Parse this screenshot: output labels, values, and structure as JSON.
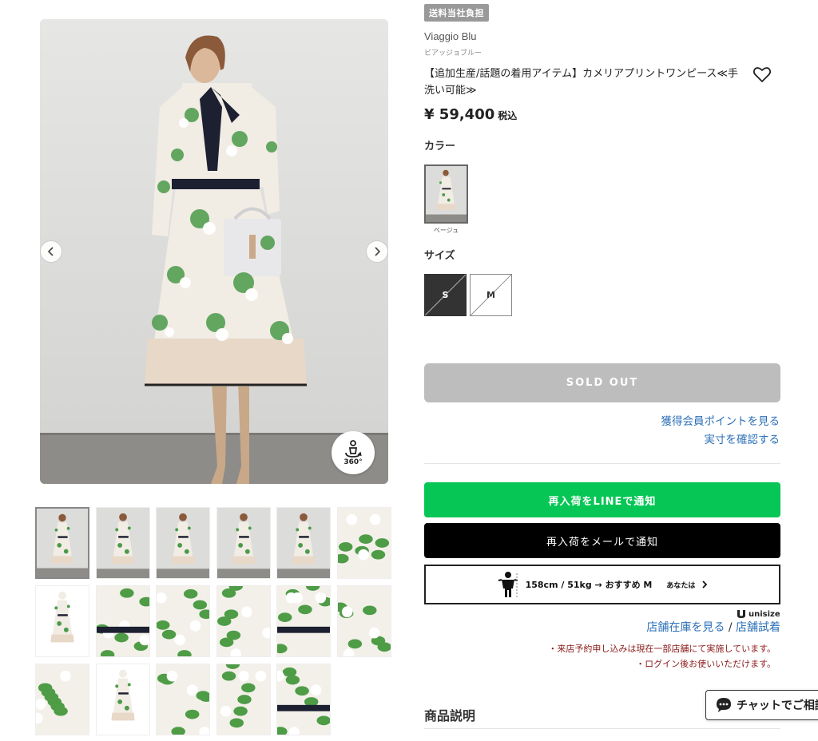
{
  "product": {
    "shipping_badge": "送料当社負担",
    "brand": "Viaggio Blu",
    "brand_kana": "ビアッジョブルー",
    "name": "【追加生産/話題の着用アイテム】カメリアプリントワンピース≪手洗い可能≫",
    "price": "¥ 59,400",
    "tax_label": "税込",
    "favorite_icon": "heart-icon"
  },
  "color": {
    "label": "カラー",
    "options": [
      {
        "name": "ベージュ",
        "selected": true
      }
    ]
  },
  "size": {
    "label": "サイズ",
    "options": [
      {
        "label": "S",
        "selected": true,
        "sold_out": true
      },
      {
        "label": "M",
        "selected": false,
        "sold_out": true
      }
    ]
  },
  "actions": {
    "sold_out": "SOLD OUT",
    "points_link": "獲得会員ポイントを見る",
    "size_link": "実寸を確認する",
    "line_notify": "再入荷をLINEで通知",
    "mail_notify": "再入荷をメールで通知"
  },
  "unisize": {
    "recommendation": "158cm / 51kg → おすすめ M",
    "you": "あなたは",
    "logo": "unisize"
  },
  "store": {
    "stock_link": "店舗在庫を見る",
    "separator": "/",
    "trial_link": "店舗試着",
    "note_1": "・来店予約申し込みは現在一部店舗にて実施しています。",
    "note_2": "・ログイン後お使いいただけます。"
  },
  "description_title": "商品説明",
  "chat": {
    "label": "チャットでご相談"
  },
  "gallery": {
    "badge_360": "360°",
    "thumbnail_count": 17,
    "active_thumbnail": 1
  },
  "colors": {
    "line_green": "#06c755",
    "link_blue": "#2c6fb7",
    "note_red": "#8b1a1a",
    "sold_out_gray": "#bdbdbd"
  }
}
